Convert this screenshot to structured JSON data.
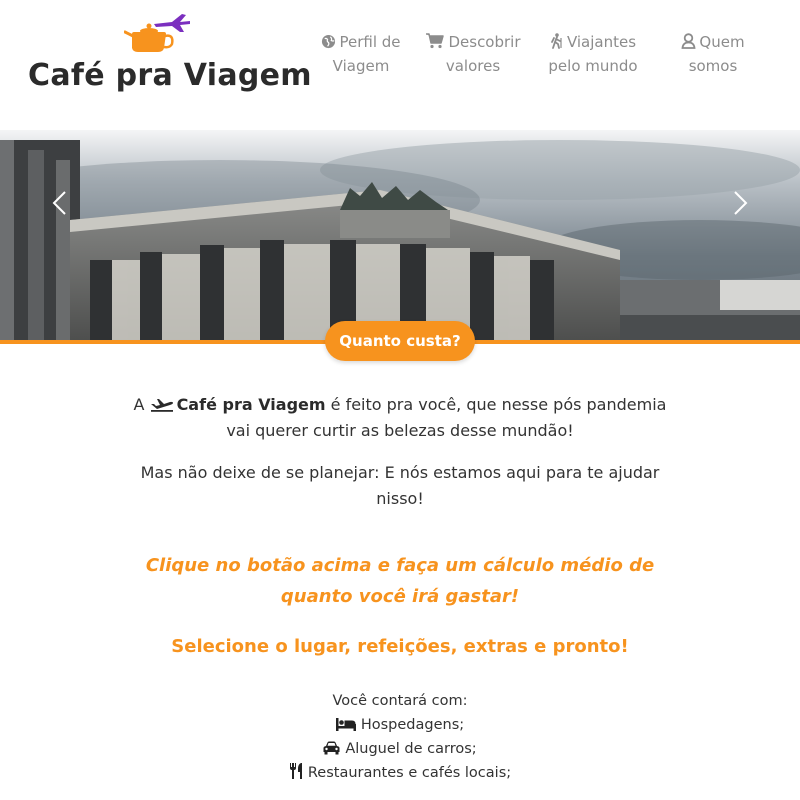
{
  "brand": {
    "name": "Café pra Viagem",
    "logo_icon": "teapot-plane-icon",
    "accent": "#f7931e",
    "plane_color": "#7b2fbf"
  },
  "nav": {
    "items": [
      {
        "line1": "Perfil de",
        "line2": "Viagem",
        "icon": "globe-icon"
      },
      {
        "line1": "Descobrir",
        "line2": "valores",
        "icon": "cart-icon"
      },
      {
        "line1": "Viajantes",
        "line2": "pelo mundo",
        "icon": "hiker-icon"
      },
      {
        "line1": "Quem",
        "line2": "somos",
        "icon": "user-icon"
      }
    ]
  },
  "hero": {
    "cta_label": "Quanto custa?",
    "prev_icon": "chevron-left-icon",
    "next_icon": "chevron-right-icon"
  },
  "intro": {
    "p1_before": "A ",
    "p1_brand": "Café pra Viagem",
    "p1_after": " é feito pra você, que nesse pós pandemia vai querer curtir as belezas desse mundão!",
    "p2": "Mas não deixe de se planejar: E nós estamos aqui para te ajudar nisso!"
  },
  "highlight": "Clique no botão acima e faça um cálculo médio de quanto você irá gastar!",
  "select_line": "Selecione o lugar, refeições, extras e pronto!",
  "features": {
    "title": "Você contará com:",
    "items": [
      {
        "label": "Hospedagens;",
        "icon": "bed-icon"
      },
      {
        "label": "Aluguel de carros;",
        "icon": "car-icon"
      },
      {
        "label": "Restaurantes e cafés locais;",
        "icon": "utensils-icon"
      }
    ]
  }
}
